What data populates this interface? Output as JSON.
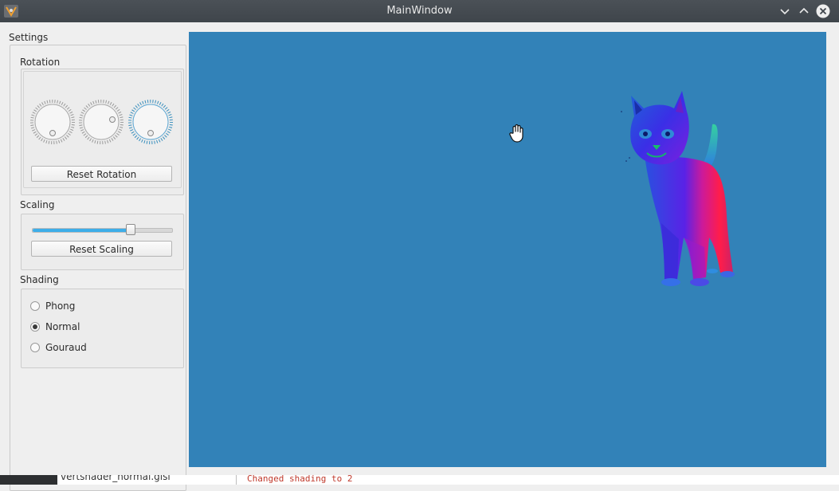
{
  "window": {
    "title": "MainWindow",
    "controls": [
      "minimize-icon",
      "maximize-icon",
      "close-icon"
    ]
  },
  "settings": {
    "label": "Settings",
    "rotation": {
      "title": "Rotation",
      "dials": [
        {
          "name": "rotation-x-dial",
          "level": 0.5
        },
        {
          "name": "rotation-y-dial",
          "level": 0.6
        },
        {
          "name": "rotation-z-dial",
          "level": 0.5
        }
      ],
      "reset_label": "Reset Rotation"
    },
    "scaling": {
      "title": "Scaling",
      "level": 0.7,
      "reset_label": "Reset Scaling"
    },
    "shading": {
      "title": "Shading",
      "options": [
        {
          "label": "Phong",
          "checked": false
        },
        {
          "label": "Normal",
          "checked": true
        },
        {
          "label": "Gouraud",
          "checked": false
        }
      ]
    }
  },
  "viewport": {
    "background": "#3282b8",
    "cursor": "open-hand-icon",
    "model": "cat-model"
  },
  "background_window": {
    "file_tab": "vertshader_normal.glsl",
    "log_line": "Changed shading to 2"
  },
  "colors": {
    "accent": "#3daee9",
    "titlebar": "#454a50"
  }
}
